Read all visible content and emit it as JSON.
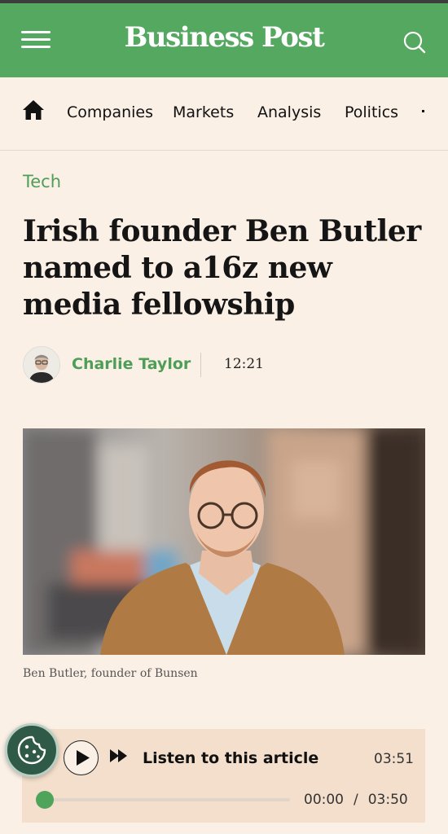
{
  "header": {
    "brand": "Business Post",
    "background_color": "#55a85f"
  },
  "nav": {
    "items": [
      "Companies",
      "Markets",
      "Analysis",
      "Politics"
    ]
  },
  "article": {
    "category": "Tech",
    "headline": "Irish founder Ben Butler named to a16z new media fellowship",
    "author": "Charlie Taylor",
    "time": "12:21",
    "image_caption": "Ben Butler, founder of Bunsen"
  },
  "audio_player": {
    "label": "Listen to this article",
    "duration_top": "03:51",
    "current_time": "00:00",
    "separator": "/",
    "total_time": "03:50",
    "progress": 0
  },
  "icons": {
    "menu": "menu-icon",
    "search": "search-icon",
    "home": "home-icon",
    "play": "play-icon",
    "fast_forward": "fast-forward-icon",
    "cookie": "cookie-icon"
  },
  "colors": {
    "accent_green": "#4e9e58",
    "page_background": "#fbf0e6",
    "player_background": "#f3dfcb"
  }
}
